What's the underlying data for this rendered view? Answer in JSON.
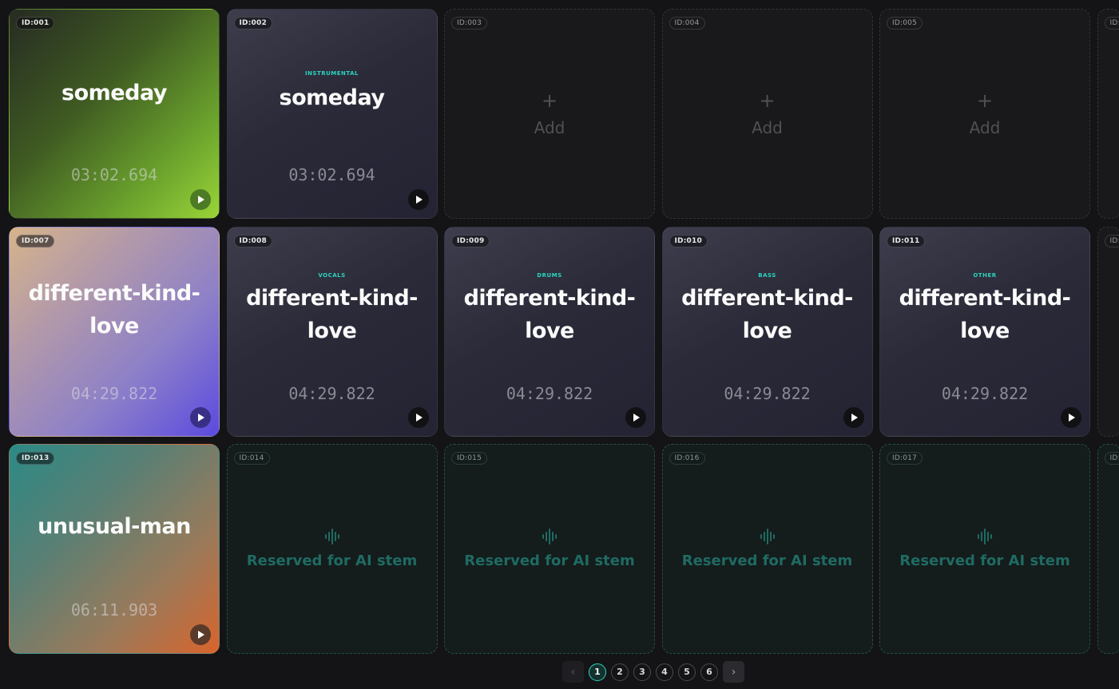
{
  "tiles": [
    {
      "id": "ID:001",
      "kind": "track",
      "style": "green",
      "title": "someday",
      "stem": "",
      "duration": "03:02.694"
    },
    {
      "id": "ID:002",
      "kind": "stem",
      "title": "someday",
      "stem": "INSTRUMENTAL",
      "duration": "03:02.694"
    },
    {
      "id": "ID:003",
      "kind": "empty",
      "plus": "+",
      "label": "Add"
    },
    {
      "id": "ID:004",
      "kind": "empty",
      "plus": "+",
      "label": "Add"
    },
    {
      "id": "ID:005",
      "kind": "empty",
      "plus": "+",
      "label": "Add"
    },
    {
      "id": "ID:",
      "kind": "sliver"
    },
    {
      "id": "ID:007",
      "kind": "track",
      "style": "purple",
      "title": "different-kind-love",
      "title_lines": [
        "different-kind-",
        "love"
      ],
      "duration": "04:29.822"
    },
    {
      "id": "ID:008",
      "kind": "stem",
      "title_lines": [
        "different-kind-",
        "love"
      ],
      "stem": "VOCALS",
      "duration": "04:29.822"
    },
    {
      "id": "ID:009",
      "kind": "stem",
      "title_lines": [
        "different-kind-",
        "love"
      ],
      "stem": "DRUMS",
      "duration": "04:29.822"
    },
    {
      "id": "ID:010",
      "kind": "stem",
      "title_lines": [
        "different-kind-",
        "love"
      ],
      "stem": "BASS",
      "duration": "04:29.822"
    },
    {
      "id": "ID:011",
      "kind": "stem",
      "title_lines": [
        "different-kind-",
        "love"
      ],
      "stem": "OTHER",
      "duration": "04:29.822"
    },
    {
      "id": "ID:",
      "kind": "sliver"
    },
    {
      "id": "ID:013",
      "kind": "track",
      "style": "teal",
      "title": "unusual-man",
      "duration": "06:11.903"
    },
    {
      "id": "ID:014",
      "kind": "reserved",
      "label": "Reserved for AI stem"
    },
    {
      "id": "ID:015",
      "kind": "reserved",
      "label": "Reserved for AI stem"
    },
    {
      "id": "ID:016",
      "kind": "reserved",
      "label": "Reserved for AI stem"
    },
    {
      "id": "ID:017",
      "kind": "reserved",
      "label": "Reserved for AI stem"
    },
    {
      "id": "ID:",
      "kind": "sliver"
    }
  ],
  "pagination": {
    "prev": "‹",
    "next": "›",
    "pages": [
      "1",
      "2",
      "3",
      "4",
      "5",
      "6"
    ],
    "current": "1"
  },
  "colors": {
    "accent": "#2dd4bf",
    "background": "#141416",
    "reserved_text": "#1f6b62"
  },
  "icons": {
    "play": "play-icon",
    "add": "plus-icon",
    "waveform": "waveform-icon"
  }
}
